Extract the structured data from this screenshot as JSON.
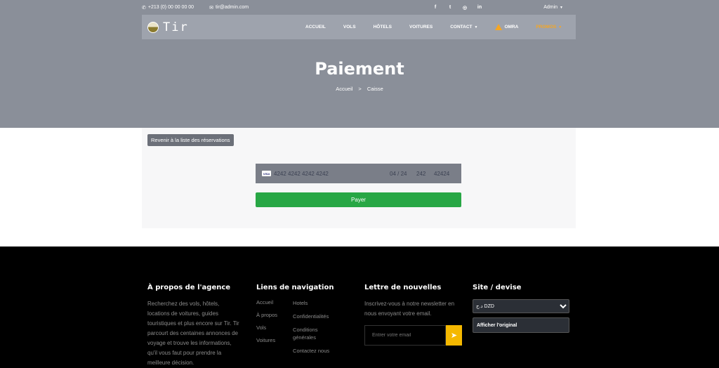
{
  "topbar": {
    "phone": "+213 (0) 00 00 00 00",
    "email": "tir@admin.com",
    "socials": [
      "f",
      "t",
      "◎",
      "in"
    ],
    "admin_label": "Admin"
  },
  "brand": {
    "name": "Tir"
  },
  "nav": {
    "items": [
      "ACCUEIL",
      "VOLS",
      "HÔTELS",
      "VOITURES",
      "CONTACT"
    ],
    "omra": "OMRA",
    "promos": "PROMOS"
  },
  "hero": {
    "title": "Paiement",
    "breadcrumb": [
      "Accueil",
      "Caisse"
    ],
    "separator": ">"
  },
  "content": {
    "back_label": "Revenir à la liste des réservations",
    "card": {
      "brand": "VISA",
      "number": "4242 4242 4242 4242",
      "expiry": "04 / 24",
      "cvc": "242",
      "zip": "42424"
    },
    "pay_label": "Payer"
  },
  "footer": {
    "about_title": "À propos de l'agence",
    "about_text": "Recherchez des vols, hôtels, locations de voitures, guides touristiques et plus encore sur Tir. Tir parcourt des centaines annonces de voyage et trouve les informations, qu'il vous faut pour prendre la meilleure décision.",
    "links_title": "Liens de navigation",
    "links_col1": [
      "Accueil",
      "À propos",
      "Vols",
      "Voitures"
    ],
    "links_col2": [
      "Hotels",
      "Confidentialités",
      "Conditions générales",
      "Contactez nous"
    ],
    "newsletter_title": "Lettre de nouvelles",
    "newsletter_text": "Inscrivez-vous à notre newsletter en nous envoyant votre email.",
    "newsletter_placeholder": "Entrer votre email",
    "site_title": "Site / devise",
    "currency_selected": "د.ج DZD",
    "show_original": "Afficher l'original"
  },
  "colors": {
    "hero_bg": "#8a8f99",
    "navbar_bg": "#9ea3ad",
    "accent": "#f5a623",
    "pay_button": "#28a745"
  }
}
